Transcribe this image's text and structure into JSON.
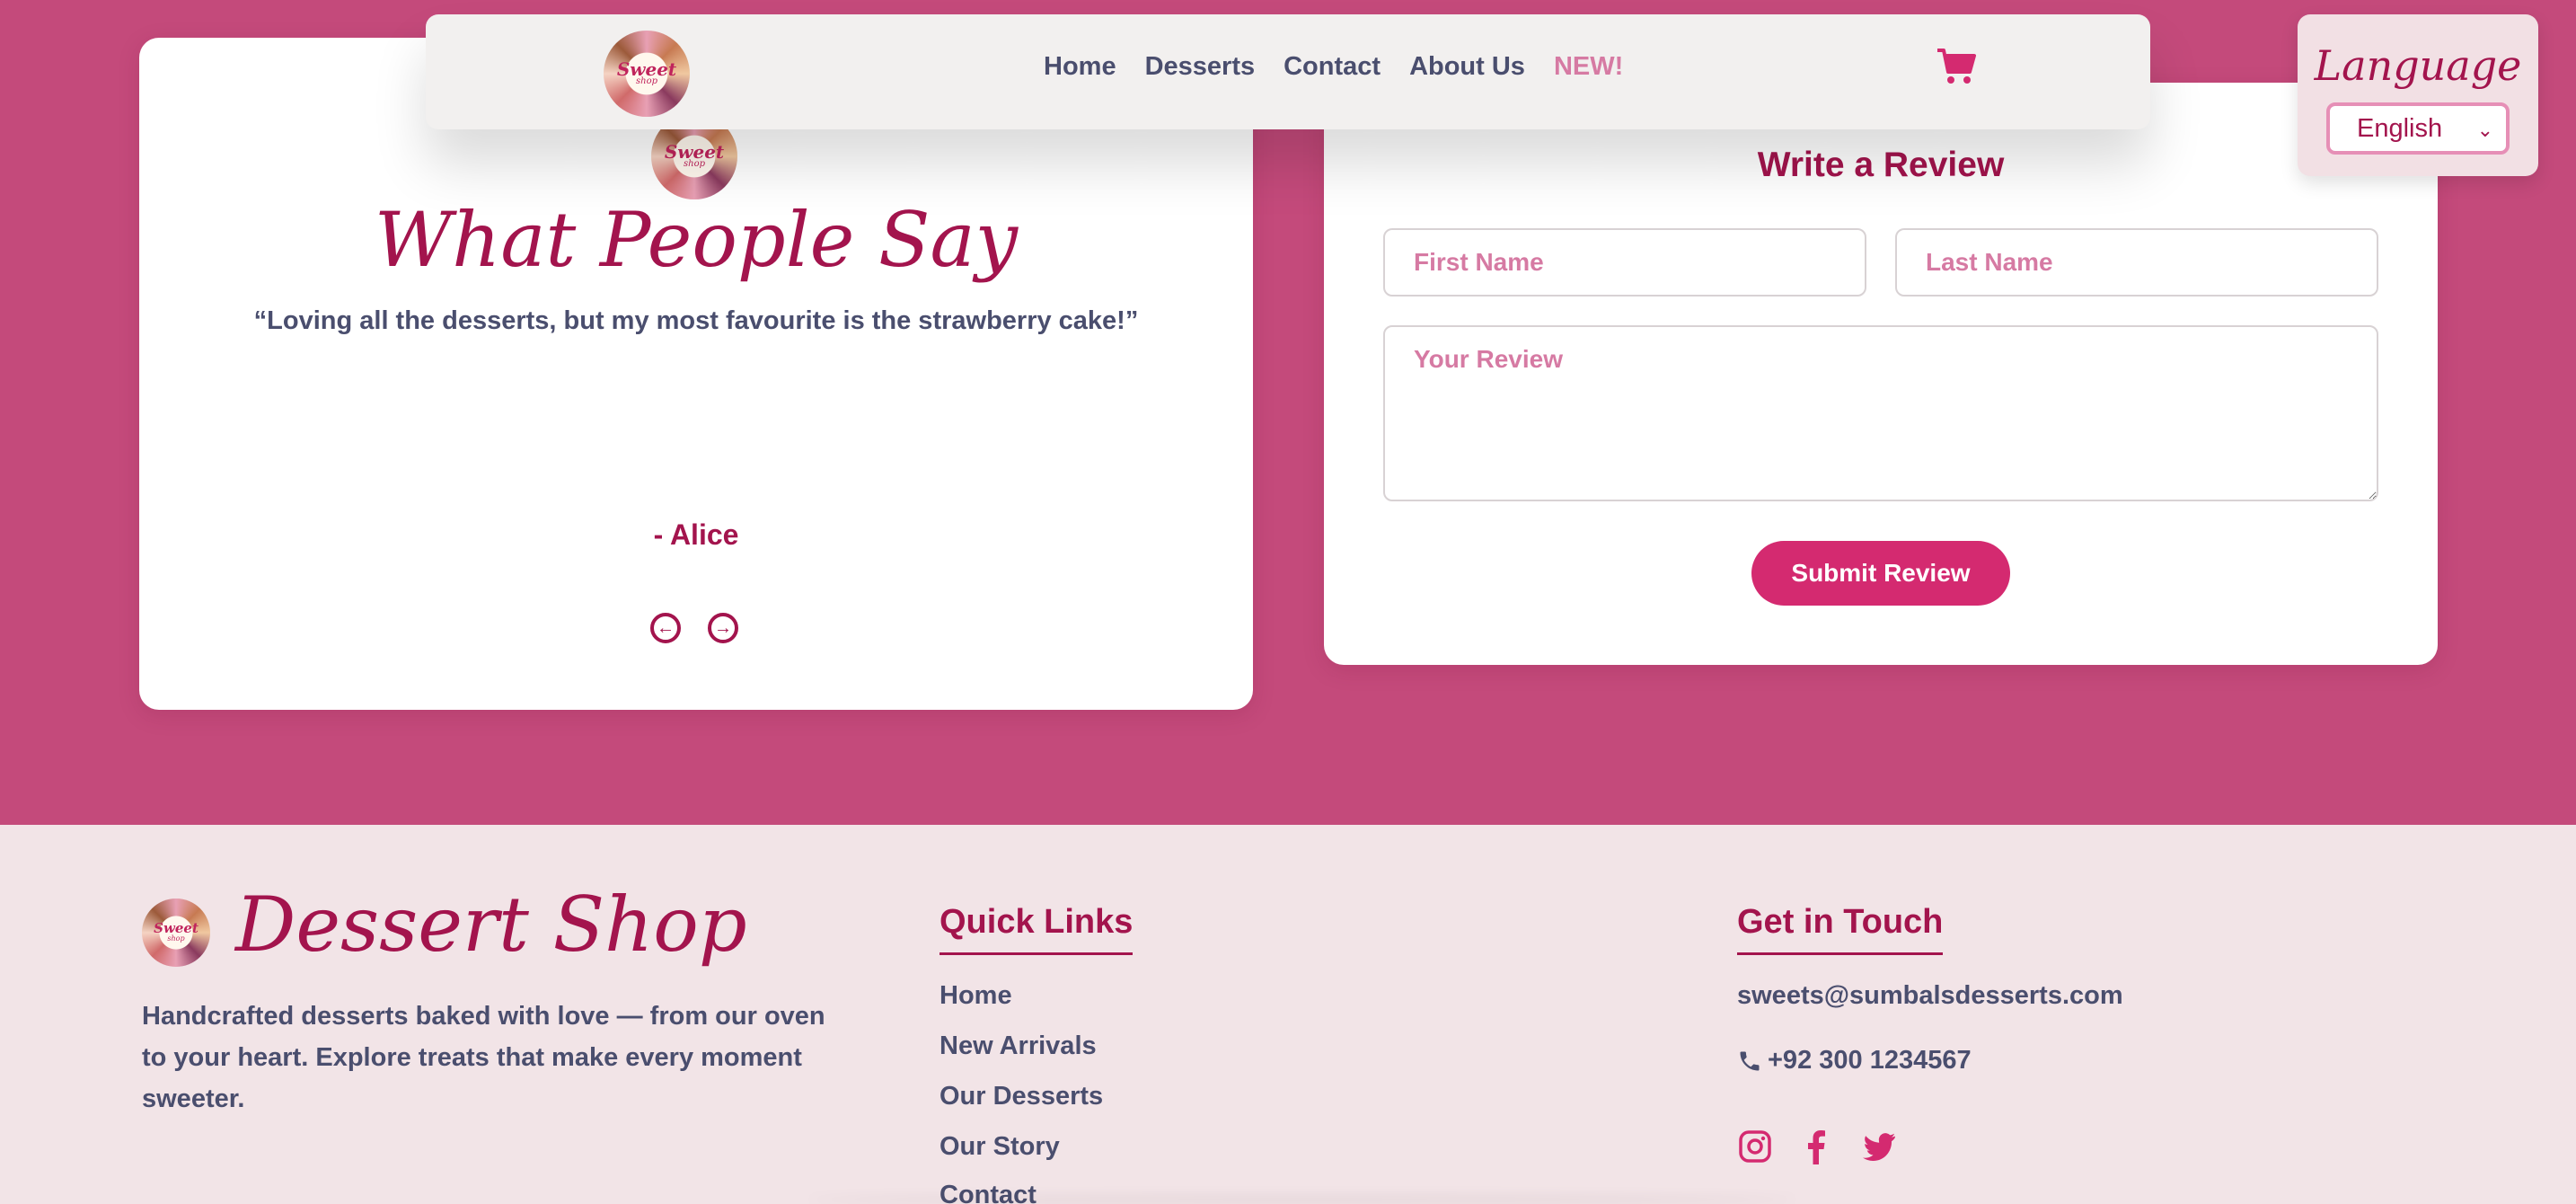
{
  "navbar": {
    "logo_line1": "Sweet",
    "logo_line2": "shop",
    "links": [
      "Home",
      "Desserts",
      "Contact",
      "About Us",
      "NEW!"
    ],
    "cart_icon": "cart-icon"
  },
  "language": {
    "title": "Language",
    "selected": "English"
  },
  "testimonial": {
    "logo_line1": "Sweet",
    "logo_line2": "shop",
    "title": "What People Say",
    "quote": "“Loving all the desserts, but my most favourite is the strawberry cake!”",
    "author": "- Alice",
    "prev_icon": "arrow-left-circle-icon",
    "next_icon": "arrow-right-circle-icon"
  },
  "review_form": {
    "title": "Write a Review",
    "first_name_placeholder": "First Name",
    "last_name_placeholder": "Last Name",
    "review_placeholder": "Your Review",
    "submit_label": "Submit Review"
  },
  "footer": {
    "logo_line1": "Sweet",
    "logo_line2": "shop",
    "brand": "Dessert Shop",
    "description": "Handcrafted desserts baked with love — from our oven to your heart. Explore treats that make every moment sweeter.",
    "quick_links_title": "Quick Links",
    "quick_links": [
      "Home",
      "New Arrivals",
      "Our Desserts",
      "Our Story",
      "Contact"
    ],
    "touch_title": "Get in Touch",
    "email": "sweets@sumbalsdesserts.com",
    "phone": "+92 300 1234567",
    "social": [
      "instagram-icon",
      "facebook-icon",
      "twitter-icon"
    ]
  },
  "colors": {
    "hero_bg": "#c44a7b",
    "accent": "#a3144d",
    "button": "#d42a70",
    "footer_bg": "#f2e4e7"
  }
}
